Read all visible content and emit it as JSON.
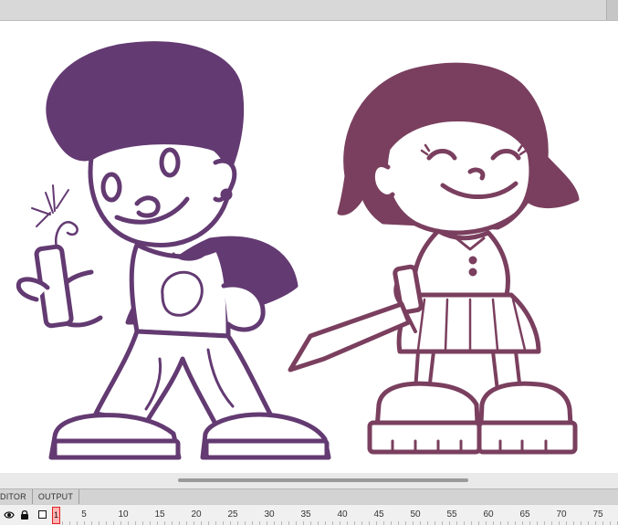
{
  "panel_tabs": [
    "DITOR",
    "OUTPUT"
  ],
  "timeline": {
    "current_frame": "1",
    "frame_labels": [
      "5",
      "10",
      "15",
      "20",
      "25",
      "30",
      "35",
      "40",
      "45",
      "50",
      "55",
      "60",
      "65",
      "70",
      "75"
    ]
  },
  "colors": {
    "ink_boy": "#633a72",
    "ink_girl": "#7a3f5e",
    "playhead": "#e02020"
  },
  "icons": [
    "eye-icon",
    "lock-icon",
    "outline-icon"
  ]
}
